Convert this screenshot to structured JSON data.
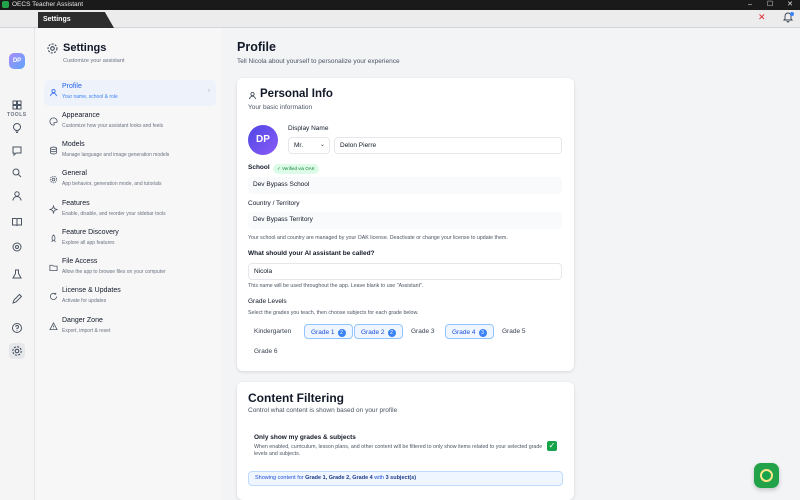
{
  "window": {
    "title": "OECS Teacher Assistant",
    "minimize": "–",
    "maximize": "☐",
    "close": "✕"
  },
  "tab": {
    "label": "Settings",
    "close_glyph": "✕"
  },
  "rail": {
    "avatar_initials": "DP",
    "section_label": "TOOLS",
    "icons": [
      "grid-icon",
      "lightbulb-icon",
      "chat-icon",
      "search-icon",
      "person-icon",
      "book-icon",
      "target-icon",
      "flask-icon",
      "pen-icon",
      "help-icon",
      "settings-icon"
    ]
  },
  "settings_panel": {
    "title": "Settings",
    "subtitle": "Customize your assistant",
    "items": [
      {
        "label": "Profile",
        "desc": "Your name, school & role",
        "icon": "user-icon"
      },
      {
        "label": "Appearance",
        "desc": "Customize how your assistant looks and feels",
        "icon": "palette-icon"
      },
      {
        "label": "Models",
        "desc": "Manage language and image generation models",
        "icon": "database-icon"
      },
      {
        "label": "General",
        "desc": "App behavior, generation mode, and tutorials",
        "icon": "sliders-icon"
      },
      {
        "label": "Features",
        "desc": "Enable, disable, and reorder your sidebar tools",
        "icon": "sparkle-icon"
      },
      {
        "label": "Feature Discovery",
        "desc": "Explore all app features",
        "icon": "rocket-icon"
      },
      {
        "label": "File Access",
        "desc": "Allow the app to browse files on your computer",
        "icon": "folder-icon"
      },
      {
        "label": "License & Updates",
        "desc": "Activate for updates",
        "icon": "refresh-icon"
      },
      {
        "label": "Danger Zone",
        "desc": "Export, import & reset",
        "icon": "warning-icon"
      }
    ],
    "active_chevron": "›"
  },
  "main": {
    "title": "Profile",
    "subtitle": "Tell Nicola about yourself to personalize your experience"
  },
  "personal_info": {
    "title": "Personal Info",
    "subtitle": "Your basic information",
    "avatar_initials": "DP",
    "display_name_label": "Display Name",
    "title_select": "Mr.",
    "display_name_value": "Delon Pierre",
    "school_label": "School",
    "verified_badge": "✓ Verified via OAK",
    "school_value": "Dev Bypass School",
    "country_label": "Country / Territory",
    "country_value": "Dev Bypass Territory",
    "license_note": "Your school and country are managed by your OAK license. Deactivate or change your license to update them.",
    "assistant_name_label": "What should your AI assistant be called?",
    "assistant_name_value": "Nicola",
    "assistant_name_note": "This name will be used throughout the app. Leave blank to use \"Assistant\".",
    "grade_levels_label": "Grade Levels",
    "grade_levels_note": "Select the grades you teach, then choose subjects for each grade below.",
    "grades": [
      {
        "label": "Kindergarten",
        "selected": false,
        "count": ""
      },
      {
        "label": "Grade 1",
        "selected": true,
        "count": "2"
      },
      {
        "label": "Grade 2",
        "selected": true,
        "count": "2"
      },
      {
        "label": "Grade 3",
        "selected": false,
        "count": ""
      },
      {
        "label": "Grade 4",
        "selected": true,
        "count": "3"
      },
      {
        "label": "Grade 5",
        "selected": false,
        "count": ""
      },
      {
        "label": "Grade 6",
        "selected": false,
        "count": ""
      }
    ]
  },
  "content_filtering": {
    "title": "Content Filtering",
    "subtitle": "Control what content is shown based on your profile",
    "only_label": "Only show my grades & subjects",
    "only_desc": "When enabled, curriculum, lesson plans, and other content will be filtered to only show items related to your selected grade levels and subjects.",
    "checked": true,
    "showing_prefix": "Showing content for ",
    "showing_grades": "Grade 1, Grade 2, Grade 4",
    "showing_with": " with ",
    "showing_count": "3 subject(s)"
  },
  "colors": {
    "accent": "#2563eb",
    "success": "#16a34a",
    "titlebar": "#1a1a1a"
  }
}
